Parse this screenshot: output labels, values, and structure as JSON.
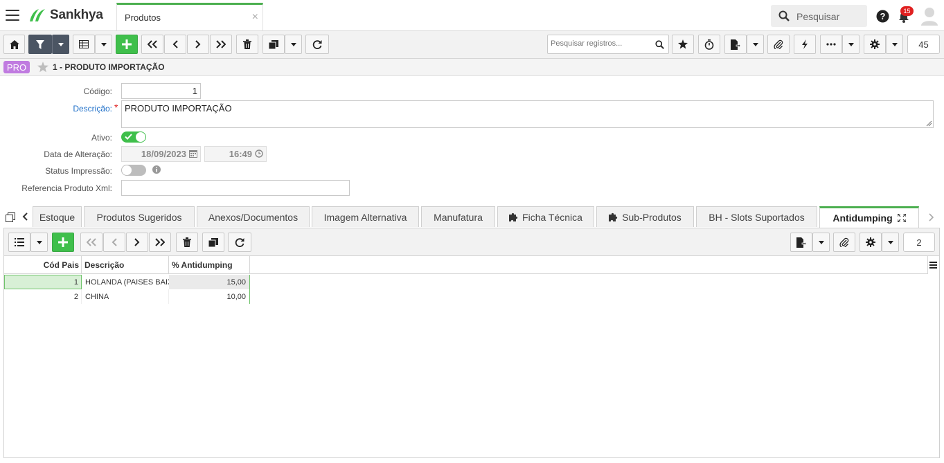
{
  "header": {
    "brand": "Sankhya",
    "tab_title": "Produtos",
    "search_placeholder": "Pesquisar",
    "notification_count": "15"
  },
  "toolbar": {
    "search_placeholder": "Pesquisar registros...",
    "page_size": "45"
  },
  "breadcrumb": {
    "badge": "PRO",
    "title": "1 - PRODUTO IMPORTAÇÃO"
  },
  "form": {
    "codigo_label": "Código:",
    "codigo_value": "1",
    "descricao_label": "Descrição:",
    "required_mark": "*",
    "descricao_value": "PRODUTO IMPORTAÇÃO",
    "ativo_label": "Ativo:",
    "ativo_value": true,
    "data_label": "Data de Alteração:",
    "data_date": "18/09/2023",
    "data_time": "16:49",
    "status_label": "Status Impressão:",
    "status_value": false,
    "ref_label": "Referencia Produto Xml:",
    "ref_value": ""
  },
  "tabs": [
    {
      "label": "Estoque"
    },
    {
      "label": "Produtos Sugeridos"
    },
    {
      "label": "Anexos/Documentos"
    },
    {
      "label": "Imagem Alternativa"
    },
    {
      "label": "Manufatura"
    },
    {
      "label": "Ficha Técnica"
    },
    {
      "label": "Sub-Produtos"
    },
    {
      "label": "BH - Slots Suportados"
    },
    {
      "label": "Antidumping"
    }
  ],
  "detail": {
    "page_size": "2",
    "columns": [
      "Cód Pais",
      "Descrição",
      "% Antidumping"
    ],
    "rows": [
      {
        "cod": "1",
        "descricao": "HOLANDA (PAISES BAIXOS)",
        "pct": "15,00"
      },
      {
        "cod": "2",
        "descricao": "CHINA",
        "pct": "10,00"
      }
    ]
  },
  "colors": {
    "accent_green": "#3fbf4b",
    "toolbar_dark": "#4b5563",
    "badge_purple": "#c07be0",
    "label_blue": "#1e6fc8",
    "notification_red": "#e02020"
  }
}
